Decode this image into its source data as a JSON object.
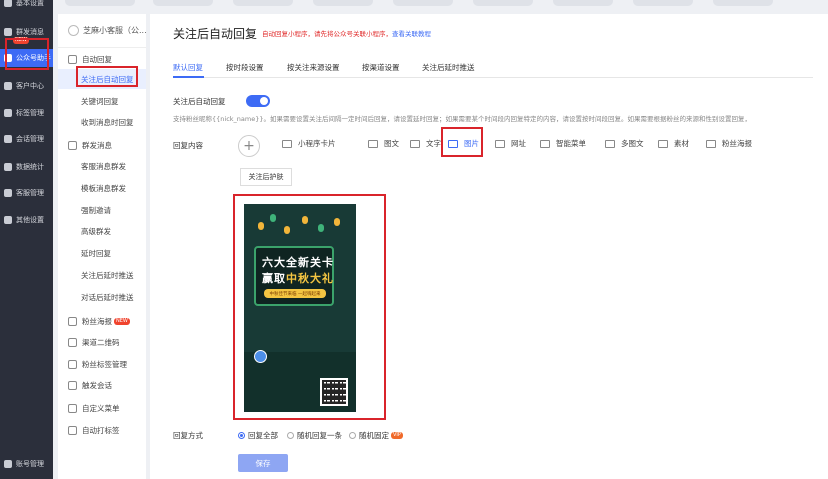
{
  "colors": {
    "nav_bg": "#2b2f3b",
    "accent": "#3d6bf5",
    "highlight_box": "#d9242b",
    "warning_text": "#e02a2a"
  },
  "nav": {
    "items": [
      {
        "label": "基本设置",
        "icon": "settings-icon"
      },
      {
        "label": "群发消息",
        "icon": "send-icon"
      },
      {
        "label": "公众号助手",
        "icon": "assistant-icon",
        "active": true,
        "badge": "NEW"
      },
      {
        "label": "客户中心",
        "icon": "user-icon"
      },
      {
        "label": "标签管理",
        "icon": "tag-icon"
      },
      {
        "label": "会话管理",
        "icon": "chat-icon"
      },
      {
        "label": "数据统计",
        "icon": "chart-icon"
      },
      {
        "label": "客服管理",
        "icon": "service-icon"
      },
      {
        "label": "其他设置",
        "icon": "gear-icon"
      },
      {
        "label": "账号管理",
        "icon": "account-icon"
      }
    ]
  },
  "submenu": {
    "account_name": "芝麻小客服（公...",
    "items": [
      {
        "label": "自动回复",
        "type": "group",
        "icon": "reply-icon"
      },
      {
        "label": "关注后自动回复",
        "type": "child",
        "active": true
      },
      {
        "label": "关键词回复",
        "type": "child"
      },
      {
        "label": "收到消息时回复",
        "type": "child"
      },
      {
        "label": "群发消息",
        "type": "group",
        "icon": "broadcast-icon"
      },
      {
        "label": "客服消息群发",
        "type": "child"
      },
      {
        "label": "模板消息群发",
        "type": "child"
      },
      {
        "label": "强制邀请",
        "type": "child"
      },
      {
        "label": "高级群发",
        "type": "child"
      },
      {
        "label": "延时回复",
        "type": "child"
      },
      {
        "label": "关注后延时推送",
        "type": "child"
      },
      {
        "label": "对话后延时推送",
        "type": "child"
      },
      {
        "label": "粉丝海报",
        "type": "group",
        "icon": "poster-icon",
        "badge": "NEW"
      },
      {
        "label": "渠道二维码",
        "type": "group",
        "icon": "qrcode-icon"
      },
      {
        "label": "粉丝标签管理",
        "type": "group",
        "icon": "tag-icon"
      },
      {
        "label": "触发会话",
        "type": "group",
        "icon": "trigger-icon"
      },
      {
        "label": "自定义菜单",
        "type": "group",
        "icon": "menu-icon"
      },
      {
        "label": "自动打标签",
        "type": "group",
        "icon": "label-icon"
      }
    ]
  },
  "page": {
    "title": "关注后自动回复",
    "note": "自动回复小程序，请先将公众号关联小程序，",
    "note_link": "查看关联教程",
    "tabs": [
      "默认回复",
      "按时段设置",
      "按关注来源设置",
      "按渠道设置",
      "关注后延时推送"
    ],
    "toggle_label": "关注后自动回复",
    "toggle_on": true,
    "hint": "支持粉丝昵称{{nick_name}}。如果需要设置关注后间隔一定时间后回复，请设置延时回复；如果需要某个时间段内回复特定的内容，请设置按时间段回复。如果需要根据粉丝的来源和性别设置回复，",
    "content_label": "回复内容",
    "types": [
      "小程序卡片",
      "图文",
      "文字",
      "图片",
      "网址",
      "智能菜单",
      "多图文",
      "素材",
      "粉丝海报"
    ],
    "active_type": "图片",
    "skin_button": "关注后护肤",
    "poster": {
      "line1": "六大全新关卡",
      "line2a": "赢取",
      "line2b": "中秋大礼",
      "sub": "中秋佳节来临 一起嗨起来"
    },
    "mode_label": "回复方式",
    "modes": [
      {
        "label": "回复全部",
        "checked": true
      },
      {
        "label": "随机回复一条",
        "checked": false
      },
      {
        "label": "随机固定",
        "checked": false,
        "badge": "VIP"
      }
    ],
    "save": "保存"
  }
}
